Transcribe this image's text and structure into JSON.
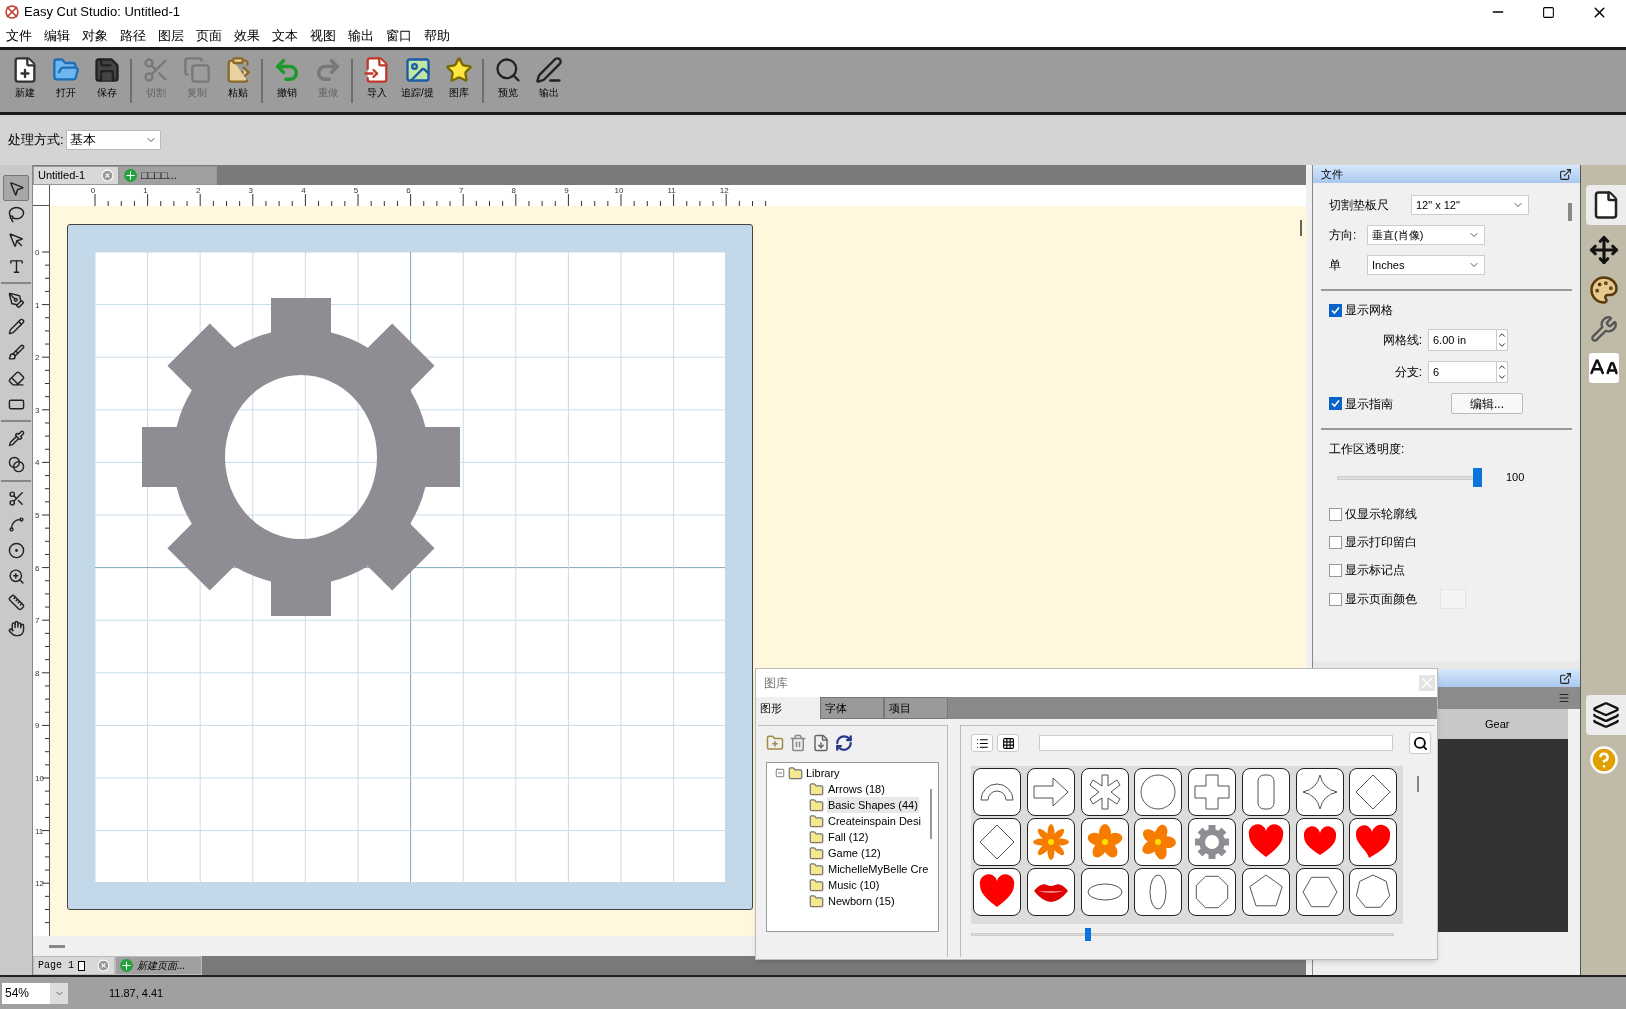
{
  "window": {
    "title": "Easy Cut Studio: Untitled-1"
  },
  "menu": [
    "文件",
    "编辑",
    "对象",
    "路径",
    "图层",
    "页面",
    "效果",
    "文本",
    "视图",
    "输出",
    "窗口",
    "帮助"
  ],
  "toolbar": [
    {
      "label": "新建",
      "disabled": false
    },
    {
      "label": "打开",
      "disabled": false
    },
    {
      "label": "保存",
      "disabled": false
    },
    {
      "label": "切割",
      "disabled": true
    },
    {
      "label": "复制",
      "disabled": true
    },
    {
      "label": "粘贴",
      "disabled": false
    },
    {
      "label": "撤销",
      "disabled": false
    },
    {
      "label": "重做",
      "disabled": true
    },
    {
      "label": "导入",
      "disabled": false
    },
    {
      "label": "追踪/提",
      "disabled": false
    },
    {
      "label": "图库",
      "disabled": false
    },
    {
      "label": "预览",
      "disabled": false
    },
    {
      "label": "输出",
      "disabled": false
    }
  ],
  "options_bar": {
    "label": "处理方式:",
    "value": "基本"
  },
  "tools": [
    {
      "selected": true
    },
    {
      "selected": false
    },
    {
      "selected": false
    },
    {
      "selected": false
    },
    {
      "selected": false
    },
    {
      "selected": false
    },
    {
      "selected": false
    },
    {
      "selected": false
    },
    {
      "selected": false
    },
    {
      "selected": false
    },
    {
      "selected": false
    },
    {
      "selected": false
    },
    {
      "selected": false
    },
    {
      "selected": false
    },
    {
      "selected": false
    },
    {
      "selected": false
    },
    {
      "selected": false
    }
  ],
  "document_tabs": [
    {
      "kind": "document",
      "label": "Untitled-1",
      "selected": true
    },
    {
      "kind": "new",
      "label": "□□□□...",
      "selected": false
    }
  ],
  "ruler": {
    "x_labels": [
      "0",
      "1",
      "2",
      "3",
      "4",
      "5",
      "6",
      "7",
      "8",
      "9",
      "10",
      "11",
      "12"
    ],
    "y_labels": [
      "0",
      "1",
      "2",
      "3",
      "4",
      "5",
      "6",
      "7",
      "8",
      "9",
      "10",
      "11",
      "12"
    ]
  },
  "page_tabs": [
    {
      "kind": "page",
      "label": "Page 1"
    },
    {
      "kind": "new",
      "label": "新建页面..."
    }
  ],
  "file_panel": {
    "title": "文件",
    "selects": [
      {
        "label": "切割垫板尺",
        "value": "12\" x 12\""
      },
      {
        "label": "方向:",
        "value": "垂直(肖像)"
      },
      {
        "label": "单",
        "value": "Inches"
      }
    ],
    "show_grid": {
      "label": "显示网格",
      "checked": true
    },
    "spinners": [
      {
        "label": "网格线:",
        "value": "6.00 in"
      },
      {
        "label": "分支:",
        "value": "6"
      }
    ],
    "show_guides": {
      "label": "显示指南",
      "checked": true
    },
    "edit_button": "编辑...",
    "opacity": {
      "label": "工作区透明度:",
      "level": 1,
      "reading": "100"
    },
    "options": [
      {
        "label": "仅显示轮廓线",
        "checked": false
      },
      {
        "label": "显示打印留白",
        "checked": false
      },
      {
        "label": "显示标记点",
        "checked": false
      },
      {
        "label": "显示页面颜色",
        "checked": false
      }
    ]
  },
  "layers_panel": {
    "rows": [
      {
        "label": "Gear"
      }
    ]
  },
  "library": {
    "title": "图库",
    "tabs": [
      {
        "label": "图形",
        "selected": true
      },
      {
        "label": "字体",
        "selected": false
      },
      {
        "label": "项目",
        "selected": false
      }
    ],
    "tree": [
      {
        "label": "Library",
        "expanded": true,
        "children": [
          {
            "label": "Arrows (18)",
            "selected": false
          },
          {
            "label": "Basic Shapes (44)",
            "selected": true
          },
          {
            "label": "Createinspain Desi",
            "selected": false
          },
          {
            "label": "Fall (12)",
            "selected": false
          },
          {
            "label": "Game (12)",
            "selected": false
          },
          {
            "label": "MichelleMyBelle Cre",
            "selected": false
          },
          {
            "label": "Music (10)",
            "selected": false
          },
          {
            "label": "Newborn (15)",
            "selected": false
          }
        ]
      }
    ],
    "thumbnail_slider": {
      "level": 0.27
    }
  },
  "status_bar": {
    "zoom": "54%",
    "coordinates": "11.87, 4.41"
  }
}
